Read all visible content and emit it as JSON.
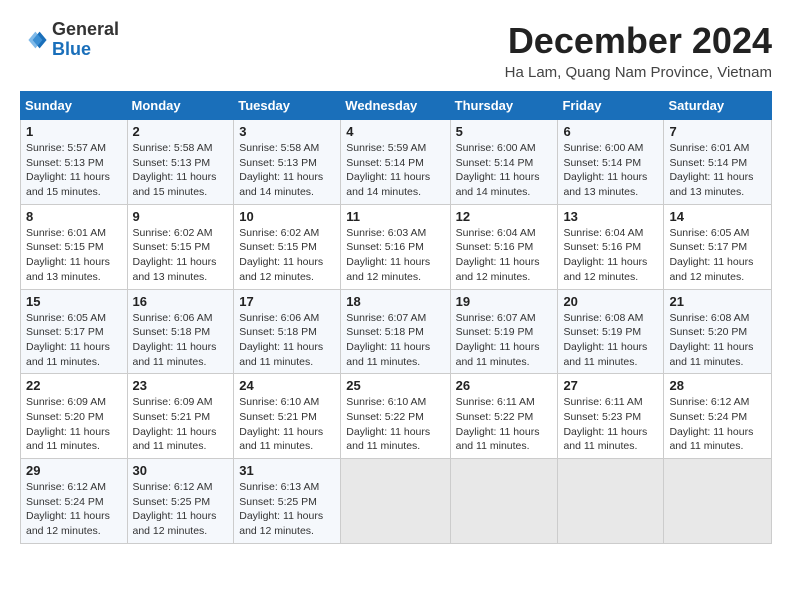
{
  "header": {
    "logo_general": "General",
    "logo_blue": "Blue",
    "month_title": "December 2024",
    "location": "Ha Lam, Quang Nam Province, Vietnam"
  },
  "calendar": {
    "headers": [
      "Sunday",
      "Monday",
      "Tuesday",
      "Wednesday",
      "Thursday",
      "Friday",
      "Saturday"
    ],
    "weeks": [
      [
        {
          "day": "1",
          "sunrise": "Sunrise: 5:57 AM",
          "sunset": "Sunset: 5:13 PM",
          "daylight": "Daylight: 11 hours and 15 minutes."
        },
        {
          "day": "2",
          "sunrise": "Sunrise: 5:58 AM",
          "sunset": "Sunset: 5:13 PM",
          "daylight": "Daylight: 11 hours and 15 minutes."
        },
        {
          "day": "3",
          "sunrise": "Sunrise: 5:58 AM",
          "sunset": "Sunset: 5:13 PM",
          "daylight": "Daylight: 11 hours and 14 minutes."
        },
        {
          "day": "4",
          "sunrise": "Sunrise: 5:59 AM",
          "sunset": "Sunset: 5:14 PM",
          "daylight": "Daylight: 11 hours and 14 minutes."
        },
        {
          "day": "5",
          "sunrise": "Sunrise: 6:00 AM",
          "sunset": "Sunset: 5:14 PM",
          "daylight": "Daylight: 11 hours and 14 minutes."
        },
        {
          "day": "6",
          "sunrise": "Sunrise: 6:00 AM",
          "sunset": "Sunset: 5:14 PM",
          "daylight": "Daylight: 11 hours and 13 minutes."
        },
        {
          "day": "7",
          "sunrise": "Sunrise: 6:01 AM",
          "sunset": "Sunset: 5:14 PM",
          "daylight": "Daylight: 11 hours and 13 minutes."
        }
      ],
      [
        {
          "day": "8",
          "sunrise": "Sunrise: 6:01 AM",
          "sunset": "Sunset: 5:15 PM",
          "daylight": "Daylight: 11 hours and 13 minutes."
        },
        {
          "day": "9",
          "sunrise": "Sunrise: 6:02 AM",
          "sunset": "Sunset: 5:15 PM",
          "daylight": "Daylight: 11 hours and 13 minutes."
        },
        {
          "day": "10",
          "sunrise": "Sunrise: 6:02 AM",
          "sunset": "Sunset: 5:15 PM",
          "daylight": "Daylight: 11 hours and 12 minutes."
        },
        {
          "day": "11",
          "sunrise": "Sunrise: 6:03 AM",
          "sunset": "Sunset: 5:16 PM",
          "daylight": "Daylight: 11 hours and 12 minutes."
        },
        {
          "day": "12",
          "sunrise": "Sunrise: 6:04 AM",
          "sunset": "Sunset: 5:16 PM",
          "daylight": "Daylight: 11 hours and 12 minutes."
        },
        {
          "day": "13",
          "sunrise": "Sunrise: 6:04 AM",
          "sunset": "Sunset: 5:16 PM",
          "daylight": "Daylight: 11 hours and 12 minutes."
        },
        {
          "day": "14",
          "sunrise": "Sunrise: 6:05 AM",
          "sunset": "Sunset: 5:17 PM",
          "daylight": "Daylight: 11 hours and 12 minutes."
        }
      ],
      [
        {
          "day": "15",
          "sunrise": "Sunrise: 6:05 AM",
          "sunset": "Sunset: 5:17 PM",
          "daylight": "Daylight: 11 hours and 11 minutes."
        },
        {
          "day": "16",
          "sunrise": "Sunrise: 6:06 AM",
          "sunset": "Sunset: 5:18 PM",
          "daylight": "Daylight: 11 hours and 11 minutes."
        },
        {
          "day": "17",
          "sunrise": "Sunrise: 6:06 AM",
          "sunset": "Sunset: 5:18 PM",
          "daylight": "Daylight: 11 hours and 11 minutes."
        },
        {
          "day": "18",
          "sunrise": "Sunrise: 6:07 AM",
          "sunset": "Sunset: 5:18 PM",
          "daylight": "Daylight: 11 hours and 11 minutes."
        },
        {
          "day": "19",
          "sunrise": "Sunrise: 6:07 AM",
          "sunset": "Sunset: 5:19 PM",
          "daylight": "Daylight: 11 hours and 11 minutes."
        },
        {
          "day": "20",
          "sunrise": "Sunrise: 6:08 AM",
          "sunset": "Sunset: 5:19 PM",
          "daylight": "Daylight: 11 hours and 11 minutes."
        },
        {
          "day": "21",
          "sunrise": "Sunrise: 6:08 AM",
          "sunset": "Sunset: 5:20 PM",
          "daylight": "Daylight: 11 hours and 11 minutes."
        }
      ],
      [
        {
          "day": "22",
          "sunrise": "Sunrise: 6:09 AM",
          "sunset": "Sunset: 5:20 PM",
          "daylight": "Daylight: 11 hours and 11 minutes."
        },
        {
          "day": "23",
          "sunrise": "Sunrise: 6:09 AM",
          "sunset": "Sunset: 5:21 PM",
          "daylight": "Daylight: 11 hours and 11 minutes."
        },
        {
          "day": "24",
          "sunrise": "Sunrise: 6:10 AM",
          "sunset": "Sunset: 5:21 PM",
          "daylight": "Daylight: 11 hours and 11 minutes."
        },
        {
          "day": "25",
          "sunrise": "Sunrise: 6:10 AM",
          "sunset": "Sunset: 5:22 PM",
          "daylight": "Daylight: 11 hours and 11 minutes."
        },
        {
          "day": "26",
          "sunrise": "Sunrise: 6:11 AM",
          "sunset": "Sunset: 5:22 PM",
          "daylight": "Daylight: 11 hours and 11 minutes."
        },
        {
          "day": "27",
          "sunrise": "Sunrise: 6:11 AM",
          "sunset": "Sunset: 5:23 PM",
          "daylight": "Daylight: 11 hours and 11 minutes."
        },
        {
          "day": "28",
          "sunrise": "Sunrise: 6:12 AM",
          "sunset": "Sunset: 5:24 PM",
          "daylight": "Daylight: 11 hours and 11 minutes."
        }
      ],
      [
        {
          "day": "29",
          "sunrise": "Sunrise: 6:12 AM",
          "sunset": "Sunset: 5:24 PM",
          "daylight": "Daylight: 11 hours and 12 minutes."
        },
        {
          "day": "30",
          "sunrise": "Sunrise: 6:12 AM",
          "sunset": "Sunset: 5:25 PM",
          "daylight": "Daylight: 11 hours and 12 minutes."
        },
        {
          "day": "31",
          "sunrise": "Sunrise: 6:13 AM",
          "sunset": "Sunset: 5:25 PM",
          "daylight": "Daylight: 11 hours and 12 minutes."
        },
        null,
        null,
        null,
        null
      ]
    ]
  }
}
